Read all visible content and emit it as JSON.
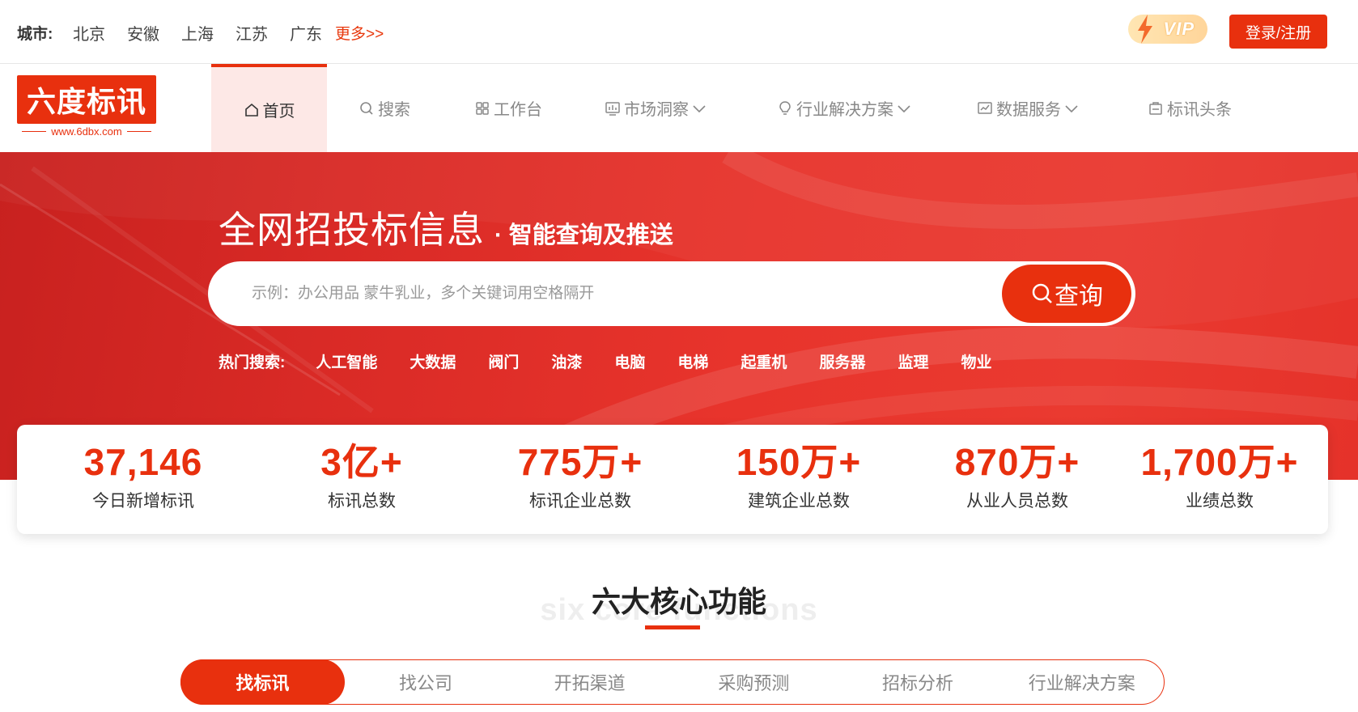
{
  "topbar": {
    "city_label": "城市:",
    "cities": [
      "北京",
      "安徽",
      "上海",
      "江苏",
      "广东"
    ],
    "more": "更多>>",
    "vip": "VIP",
    "login": "登录/注册"
  },
  "logo": {
    "text": "六度标讯",
    "url": "www.6dbx.com"
  },
  "nav": [
    {
      "label": "首页",
      "icon": "home-icon",
      "active": true
    },
    {
      "label": "搜索",
      "icon": "search-icon"
    },
    {
      "label": "工作台",
      "icon": "grid-icon"
    },
    {
      "label": "市场洞察",
      "icon": "monitor-icon",
      "dropdown": true
    },
    {
      "label": "行业解决方案",
      "icon": "bulb-icon",
      "dropdown": true
    },
    {
      "label": "数据服务",
      "icon": "chart-icon",
      "dropdown": true
    },
    {
      "label": "标讯头条",
      "icon": "news-icon"
    }
  ],
  "hero": {
    "title": "全网招投标信息",
    "subtitle": "· 智能查询及推送",
    "search_placeholder": "示例：办公用品 蒙牛乳业，多个关键词用空格隔开",
    "search_button": "查询",
    "hot_label": "热门搜索:",
    "hot_keywords": [
      "人工智能",
      "大数据",
      "阀门",
      "油漆",
      "电脑",
      "电梯",
      "起重机",
      "服务器",
      "监理",
      "物业"
    ]
  },
  "stats": [
    {
      "value": "37,146",
      "label": "今日新增标讯"
    },
    {
      "value": "3亿+",
      "label": "标讯总数"
    },
    {
      "value": "775万+",
      "label": "标讯企业总数"
    },
    {
      "value": "150万+",
      "label": "建筑企业总数"
    },
    {
      "value": "870万+",
      "label": "从业人员总数"
    },
    {
      "value": "1,700万+",
      "label": "业绩总数"
    }
  ],
  "section": {
    "title": "六大核心功能",
    "subtitle_en": "six core functions",
    "tabs": [
      "找标讯",
      "找公司",
      "开拓渠道",
      "采购预测",
      "招标分析",
      "行业解决方案"
    ],
    "active_tab": 0
  },
  "colors": {
    "brand": "#e8300e",
    "nav_active_bg": "#fde8e6"
  }
}
